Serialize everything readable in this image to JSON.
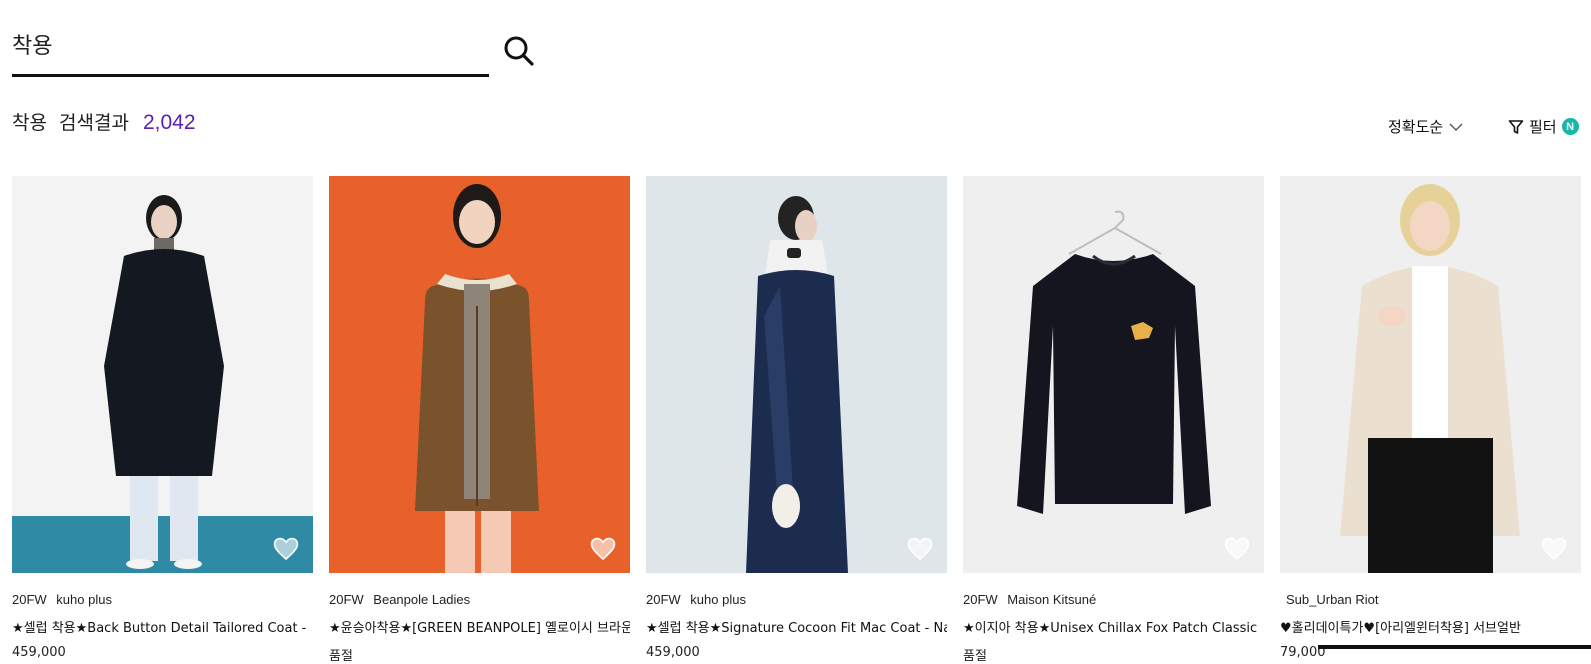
{
  "search": {
    "value": "착용",
    "icon": "search-icon"
  },
  "results": {
    "query": "착용",
    "label": "검색결과",
    "count": "2,042"
  },
  "sort": {
    "label": "정확도순",
    "icon": "chevron-down-icon"
  },
  "filter": {
    "label": "필터",
    "badge": "N",
    "icon": "filter-icon",
    "badge_color": "#14b8a6"
  },
  "accent_color": "#5b21b6",
  "products": [
    {
      "season": "20FW",
      "brand": "kuho plus",
      "title": "★셀럽 착용★Back Button Detail Tailored Coat -",
      "price": "459,000"
    },
    {
      "season": "20FW",
      "brand": "Beanpole Ladies",
      "title": "★윤승아착용★[GREEN BEANPOLE] 옐로이시 브라운",
      "price": "품절"
    },
    {
      "season": "20FW",
      "brand": "kuho plus",
      "title": "★셀럽 착용★Signature Cocoon Fit Mac Coat - Navy",
      "price": "459,000"
    },
    {
      "season": "20FW",
      "brand": "Maison Kitsuné",
      "title": "★이지아 착용★Unisex Chillax Fox Patch Classic",
      "price": "품절"
    },
    {
      "season": "",
      "brand": "Sub_Urban Riot",
      "title": "♥홀리데이특가♥[아리엘윈터착용] 서브얼반",
      "price": "79,000"
    }
  ]
}
